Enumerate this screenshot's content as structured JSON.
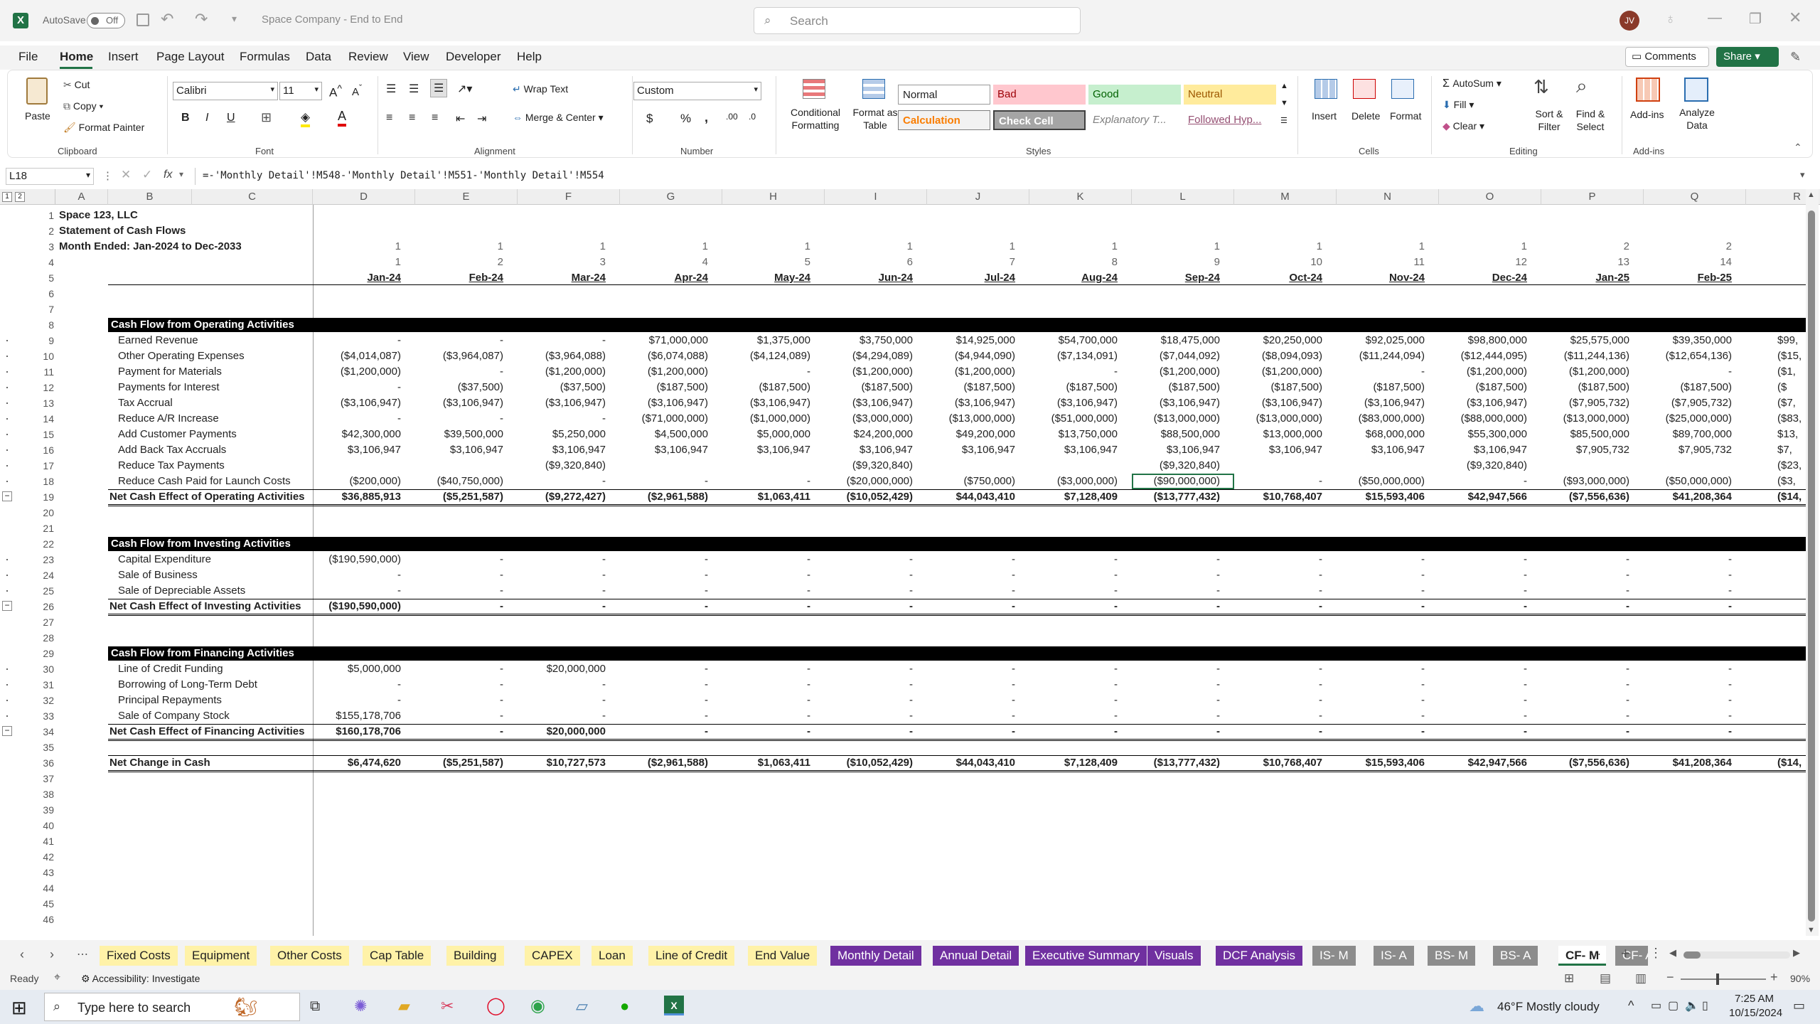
{
  "app": {
    "autosave_label": "AutoSave",
    "autosave_state": "Off",
    "doc_title": "Space Company - End to End",
    "search_placeholder": "Search",
    "avatar": "JV"
  },
  "menu": [
    "File",
    "Home",
    "Insert",
    "Page Layout",
    "Formulas",
    "Data",
    "Review",
    "View",
    "Developer",
    "Help"
  ],
  "menu_right": {
    "comments": "Comments",
    "share": "Share"
  },
  "ribbon": {
    "clipboard": {
      "paste": "Paste",
      "cut": "Cut",
      "copy": "Copy",
      "format_painter": "Format Painter",
      "label": "Clipboard"
    },
    "font": {
      "name": "Calibri",
      "size": "11",
      "label": "Font",
      "bold": "B",
      "italic": "I",
      "underline": "U"
    },
    "alignment": {
      "wrap": "Wrap Text",
      "merge": "Merge & Center",
      "label": "Alignment"
    },
    "number": {
      "format": "Custom",
      "label": "Number",
      "currency": "$",
      "percent": "%",
      "comma": ","
    },
    "styles": {
      "conditional": "Conditional Formatting",
      "format_table": "Format as Table",
      "normal": "Normal",
      "bad": "Bad",
      "good": "Good",
      "neutral": "Neutral",
      "calculation": "Calculation",
      "check_cell": "Check Cell",
      "explanatory": "Explanatory T...",
      "followed": "Followed Hyp...",
      "label": "Styles"
    },
    "cells": {
      "insert": "Insert",
      "delete": "Delete",
      "format": "Format",
      "label": "Cells"
    },
    "editing": {
      "autosum": "AutoSum",
      "fill": "Fill",
      "clear": "Clear",
      "sort": "Sort & Filter",
      "find": "Find & Select",
      "label": "Editing"
    },
    "addins": {
      "addins": "Add-ins",
      "analyze": "Analyze Data",
      "label": "Add-ins"
    }
  },
  "formula": {
    "namebox": "L18",
    "fx": "fx",
    "text": "=-'Monthly Detail'!M548-'Monthly Detail'!M551-'Monthly Detail'!M554"
  },
  "grid": {
    "columns": [
      "A",
      "B",
      "C",
      "D",
      "E",
      "F",
      "G",
      "H",
      "I",
      "J",
      "K",
      "L",
      "M",
      "N",
      "O",
      "P",
      "Q",
      "R"
    ],
    "title_lines": [
      "Space 123, LLC",
      "Statement of Cash Flows",
      "Month Ended: Jan-2024 to Dec-2033"
    ],
    "row3": [
      "1",
      "1",
      "1",
      "1",
      "1",
      "1",
      "1",
      "1",
      "1",
      "1",
      "1",
      "1",
      "2",
      "2"
    ],
    "row4": [
      "1",
      "2",
      "3",
      "4",
      "5",
      "6",
      "7",
      "8",
      "9",
      "10",
      "11",
      "12",
      "13",
      "14"
    ],
    "months": [
      "Jan-24",
      "Feb-24",
      "Mar-24",
      "Apr-24",
      "May-24",
      "Jun-24",
      "Jul-24",
      "Aug-24",
      "Sep-24",
      "Oct-24",
      "Nov-24",
      "Dec-24",
      "Jan-25",
      "Feb-25"
    ],
    "rows": [
      {
        "r": 1
      },
      {
        "r": 2
      },
      {
        "r": 3
      },
      {
        "r": 4
      },
      {
        "r": 5
      },
      {
        "r": 6
      },
      {
        "r": 7
      },
      {
        "r": 8,
        "section": "Cash Flow from Operating Activities"
      },
      {
        "r": 9,
        "label": "Earned Revenue",
        "v": [
          "-",
          "-",
          "-",
          "$71,000,000",
          "$1,375,000",
          "$3,750,000",
          "$14,925,000",
          "$54,700,000",
          "$18,475,000",
          "$20,250,000",
          "$92,025,000",
          "$98,800,000",
          "$25,575,000",
          "$39,350,000"
        ],
        "r_col": "$99,"
      },
      {
        "r": 10,
        "label": "Other Operating Expenses",
        "v": [
          "($4,014,087)",
          "($3,964,087)",
          "($3,964,088)",
          "($6,074,088)",
          "($4,124,089)",
          "($4,294,089)",
          "($4,944,090)",
          "($7,134,091)",
          "($7,044,092)",
          "($8,094,093)",
          "($11,244,094)",
          "($12,444,095)",
          "($11,244,136)",
          "($12,654,136)"
        ],
        "r_col": "($15,"
      },
      {
        "r": 11,
        "label": "Payment for Materials",
        "v": [
          "($1,200,000)",
          "-",
          "($1,200,000)",
          "($1,200,000)",
          "-",
          "($1,200,000)",
          "($1,200,000)",
          "-",
          "($1,200,000)",
          "($1,200,000)",
          "-",
          "($1,200,000)",
          "($1,200,000)",
          "-"
        ],
        "r_col": "($1,"
      },
      {
        "r": 12,
        "label": "Payments for Interest",
        "v": [
          "-",
          "($37,500)",
          "($37,500)",
          "($187,500)",
          "($187,500)",
          "($187,500)",
          "($187,500)",
          "($187,500)",
          "($187,500)",
          "($187,500)",
          "($187,500)",
          "($187,500)",
          "($187,500)",
          "($187,500)"
        ],
        "r_col": "($"
      },
      {
        "r": 13,
        "label": "Tax Accrual",
        "v": [
          "($3,106,947)",
          "($3,106,947)",
          "($3,106,947)",
          "($3,106,947)",
          "($3,106,947)",
          "($3,106,947)",
          "($3,106,947)",
          "($3,106,947)",
          "($3,106,947)",
          "($3,106,947)",
          "($3,106,947)",
          "($3,106,947)",
          "($7,905,732)",
          "($7,905,732)"
        ],
        "r_col": "($7,"
      },
      {
        "r": 14,
        "label": "Reduce A/R Increase",
        "v": [
          "-",
          "-",
          "-",
          "($71,000,000)",
          "($1,000,000)",
          "($3,000,000)",
          "($13,000,000)",
          "($51,000,000)",
          "($13,000,000)",
          "($13,000,000)",
          "($83,000,000)",
          "($88,000,000)",
          "($13,000,000)",
          "($25,000,000)"
        ],
        "r_col": "($83,"
      },
      {
        "r": 15,
        "label": "Add Customer Payments",
        "v": [
          "$42,300,000",
          "$39,500,000",
          "$5,250,000",
          "$4,500,000",
          "$5,000,000",
          "$24,200,000",
          "$49,200,000",
          "$13,750,000",
          "$88,500,000",
          "$13,000,000",
          "$68,000,000",
          "$55,300,000",
          "$85,500,000",
          "$89,700,000"
        ],
        "r_col": "$13,"
      },
      {
        "r": 16,
        "label": "Add Back Tax Accruals",
        "v": [
          "$3,106,947",
          "$3,106,947",
          "$3,106,947",
          "$3,106,947",
          "$3,106,947",
          "$3,106,947",
          "$3,106,947",
          "$3,106,947",
          "$3,106,947",
          "$3,106,947",
          "$3,106,947",
          "$3,106,947",
          "$7,905,732",
          "$7,905,732"
        ],
        "r_col": "$7,"
      },
      {
        "r": 17,
        "label": "Reduce Tax Payments",
        "v": [
          "",
          "",
          "($9,320,840)",
          "",
          "",
          "($9,320,840)",
          "",
          "",
          "($9,320,840)",
          "",
          "",
          "($9,320,840)",
          "",
          ""
        ],
        "r_col": "($23,"
      },
      {
        "r": 18,
        "label": "Reduce Cash Paid for Launch Costs",
        "v": [
          "($200,000)",
          "($40,750,000)",
          "-",
          "-",
          "-",
          "($20,000,000)",
          "($750,000)",
          "($3,000,000)",
          "($90,000,000)",
          "-",
          "($50,000,000)",
          "-",
          "($93,000,000)",
          "($50,000,000)"
        ],
        "r_col": "($3,"
      },
      {
        "r": 19,
        "total": "Net Cash Effect of Operating Activities",
        "v": [
          "$36,885,913",
          "($5,251,587)",
          "($9,272,427)",
          "($2,961,588)",
          "$1,063,411",
          "($10,052,429)",
          "$44,043,410",
          "$7,128,409",
          "($13,777,432)",
          "$10,768,407",
          "$15,593,406",
          "$42,947,566",
          "($7,556,636)",
          "$41,208,364"
        ],
        "r_col": "($14,"
      },
      {
        "r": 20
      },
      {
        "r": 21
      },
      {
        "r": 22,
        "section": "Cash Flow from Investing Activities"
      },
      {
        "r": 23,
        "label": "Capital Expenditure",
        "v": [
          "($190,590,000)",
          "-",
          "-",
          "-",
          "-",
          "-",
          "-",
          "-",
          "-",
          "-",
          "-",
          "-",
          "-",
          "-"
        ]
      },
      {
        "r": 24,
        "label": "Sale of Business",
        "v": [
          "-",
          "-",
          "-",
          "-",
          "-",
          "-",
          "-",
          "-",
          "-",
          "-",
          "-",
          "-",
          "-",
          "-"
        ]
      },
      {
        "r": 25,
        "label": "Sale of Depreciable Assets",
        "v": [
          "-",
          "-",
          "-",
          "-",
          "-",
          "-",
          "-",
          "-",
          "-",
          "-",
          "-",
          "-",
          "-",
          "-"
        ]
      },
      {
        "r": 26,
        "total": "Net Cash Effect of Investing Activities",
        "v": [
          "($190,590,000)",
          "-",
          "-",
          "-",
          "-",
          "-",
          "-",
          "-",
          "-",
          "-",
          "-",
          "-",
          "-",
          "-"
        ]
      },
      {
        "r": 27
      },
      {
        "r": 28
      },
      {
        "r": 29,
        "section": "Cash Flow from Financing Activities"
      },
      {
        "r": 30,
        "label": "Line of Credit Funding",
        "v": [
          "$5,000,000",
          "-",
          "$20,000,000",
          "-",
          "-",
          "-",
          "-",
          "-",
          "-",
          "-",
          "-",
          "-",
          "-",
          "-"
        ]
      },
      {
        "r": 31,
        "label": "Borrowing of Long-Term Debt",
        "v": [
          "-",
          "-",
          "-",
          "-",
          "-",
          "-",
          "-",
          "-",
          "-",
          "-",
          "-",
          "-",
          "-",
          "-"
        ]
      },
      {
        "r": 32,
        "label": "Principal Repayments",
        "v": [
          "-",
          "-",
          "-",
          "-",
          "-",
          "-",
          "-",
          "-",
          "-",
          "-",
          "-",
          "-",
          "-",
          "-"
        ]
      },
      {
        "r": 33,
        "label": "Sale of Company Stock",
        "v": [
          "$155,178,706",
          "-",
          "-",
          "-",
          "-",
          "-",
          "-",
          "-",
          "-",
          "-",
          "-",
          "-",
          "-",
          "-"
        ]
      },
      {
        "r": 34,
        "total": "Net Cash Effect of Financing Activities",
        "v": [
          "$160,178,706",
          "-",
          "$20,000,000",
          "-",
          "-",
          "-",
          "-",
          "-",
          "-",
          "-",
          "-",
          "-",
          "-",
          "-"
        ]
      },
      {
        "r": 35
      },
      {
        "r": 36,
        "total": "Net Change in Cash",
        "v": [
          "$6,474,620",
          "($5,251,587)",
          "$10,727,573",
          "($2,961,588)",
          "$1,063,411",
          "($10,052,429)",
          "$44,043,410",
          "$7,128,409",
          "($13,777,432)",
          "$10,768,407",
          "$15,593,406",
          "$42,947,566",
          "($7,556,636)",
          "$41,208,364"
        ],
        "r_col": "($14,"
      },
      {
        "r": 37
      },
      {
        "r": 38
      },
      {
        "r": 39
      },
      {
        "r": 40
      },
      {
        "r": 41
      },
      {
        "r": 42
      },
      {
        "r": 43
      },
      {
        "r": 44
      },
      {
        "r": 45
      },
      {
        "r": 46
      }
    ]
  },
  "sheet_tabs": [
    {
      "label": "Fixed Costs",
      "style": "y"
    },
    {
      "label": "Equipment",
      "style": "y"
    },
    {
      "label": "Other Costs",
      "style": "y"
    },
    {
      "label": "Cap Table",
      "style": "y"
    },
    {
      "label": "Building",
      "style": "y"
    },
    {
      "label": "CAPEX",
      "style": "y"
    },
    {
      "label": "Loan",
      "style": "y"
    },
    {
      "label": "Line of Credit",
      "style": "y"
    },
    {
      "label": "End Value",
      "style": "y"
    },
    {
      "label": "Monthly Detail",
      "style": "p"
    },
    {
      "label": "Annual Detail",
      "style": "p"
    },
    {
      "label": "Executive Summary",
      "style": "p"
    },
    {
      "label": "Visuals",
      "style": "p"
    },
    {
      "label": "DCF Analysis",
      "style": "p"
    },
    {
      "label": "IS- M",
      "style": "g"
    },
    {
      "label": "IS- A",
      "style": "g"
    },
    {
      "label": "BS- M",
      "style": "g"
    },
    {
      "label": "BS- A",
      "style": "g"
    },
    {
      "label": "CF- M",
      "style": "active"
    },
    {
      "label": "CF- A",
      "style": "g"
    }
  ],
  "status": {
    "ready": "Ready",
    "accessibility": "Accessibility: Investigate",
    "zoom": "90%"
  },
  "taskbar": {
    "search": "Type here to search",
    "weather": "46°F  Mostly cloudy",
    "time": "7:25 AM",
    "date": "10/15/2024"
  },
  "colors": {
    "excel_green": "#217346",
    "section_black": "#000000",
    "tab_yellow": "#fff2a8",
    "tab_purple": "#7030a0",
    "tab_gray": "#8c8c8c"
  }
}
